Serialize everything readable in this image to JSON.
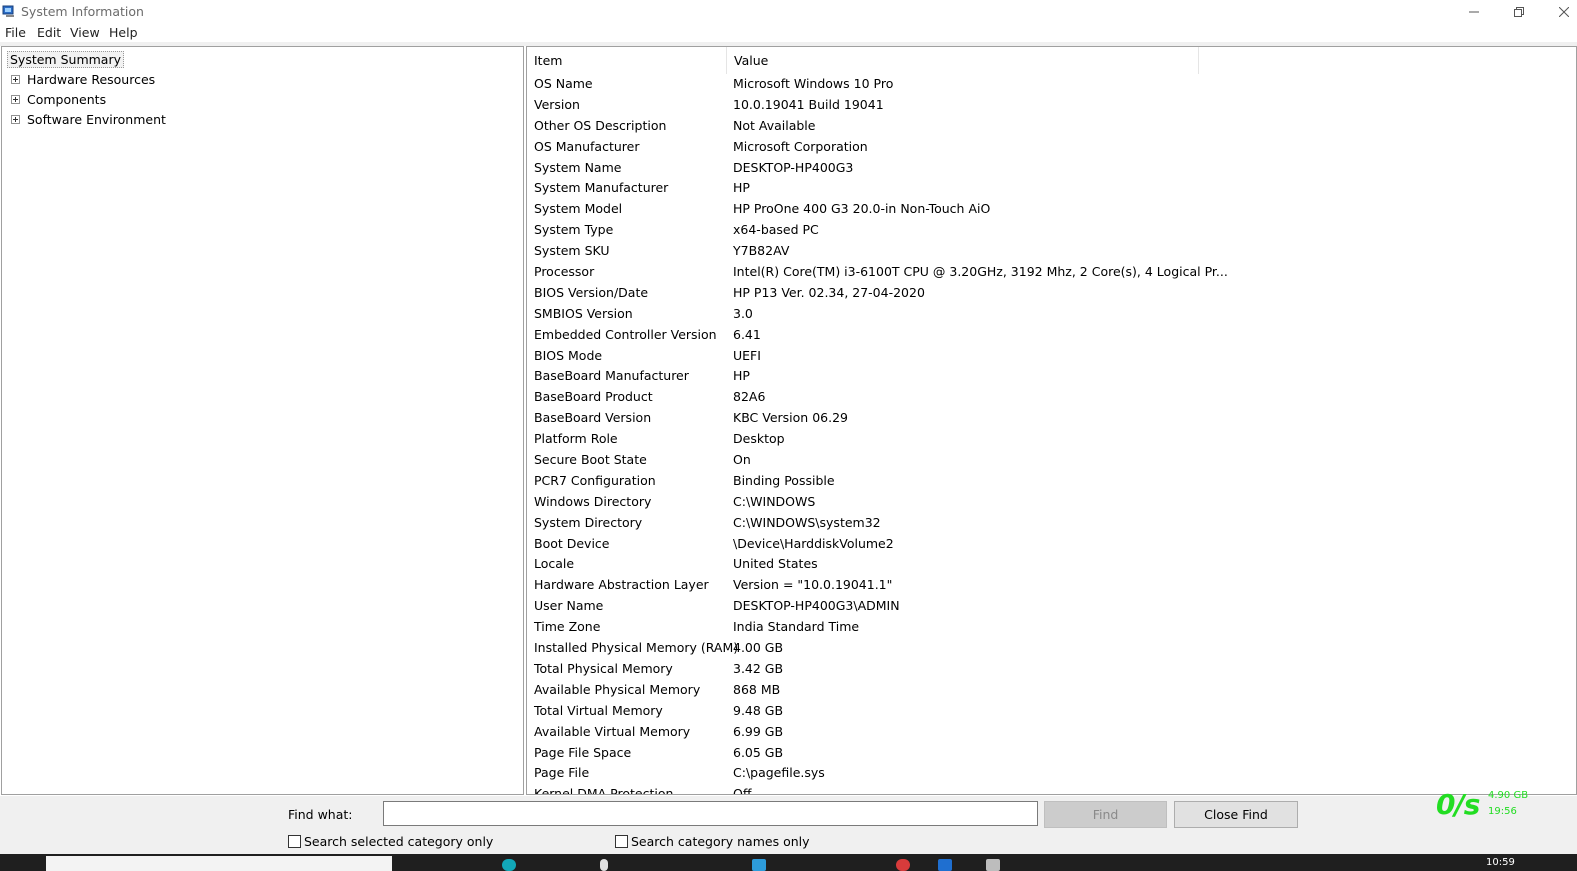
{
  "window": {
    "title": "System Information",
    "icon": "system-information-icon"
  },
  "menu": [
    "File",
    "Edit",
    "View",
    "Help"
  ],
  "tree": {
    "root": "System Summary",
    "children": [
      "Hardware Resources",
      "Components",
      "Software Environment"
    ]
  },
  "list": {
    "headers": {
      "item": "Item",
      "value": "Value"
    },
    "rows": [
      {
        "item": "OS Name",
        "value": "Microsoft Windows 10 Pro"
      },
      {
        "item": "Version",
        "value": "10.0.19041 Build 19041"
      },
      {
        "item": "Other OS Description",
        "value": "Not Available"
      },
      {
        "item": "OS Manufacturer",
        "value": "Microsoft Corporation"
      },
      {
        "item": "System Name",
        "value": "DESKTOP-HP400G3"
      },
      {
        "item": "System Manufacturer",
        "value": "HP"
      },
      {
        "item": "System Model",
        "value": "HP ProOne 400 G3 20.0-in Non-Touch AiO"
      },
      {
        "item": "System Type",
        "value": "x64-based PC"
      },
      {
        "item": "System SKU",
        "value": "Y7B82AV"
      },
      {
        "item": "Processor",
        "value": "Intel(R) Core(TM) i3-6100T CPU @ 3.20GHz, 3192 Mhz, 2 Core(s), 4 Logical Pr..."
      },
      {
        "item": "BIOS Version/Date",
        "value": "HP P13 Ver. 02.34, 27-04-2020"
      },
      {
        "item": "SMBIOS Version",
        "value": "3.0"
      },
      {
        "item": "Embedded Controller Version",
        "value": "6.41"
      },
      {
        "item": "BIOS Mode",
        "value": "UEFI"
      },
      {
        "item": "BaseBoard Manufacturer",
        "value": "HP"
      },
      {
        "item": "BaseBoard Product",
        "value": "82A6"
      },
      {
        "item": "BaseBoard Version",
        "value": "KBC Version 06.29"
      },
      {
        "item": "Platform Role",
        "value": "Desktop"
      },
      {
        "item": "Secure Boot State",
        "value": "On"
      },
      {
        "item": "PCR7 Configuration",
        "value": "Binding Possible"
      },
      {
        "item": "Windows Directory",
        "value": "C:\\WINDOWS"
      },
      {
        "item": "System Directory",
        "value": "C:\\WINDOWS\\system32"
      },
      {
        "item": "Boot Device",
        "value": "\\Device\\HarddiskVolume2"
      },
      {
        "item": "Locale",
        "value": "United States"
      },
      {
        "item": "Hardware Abstraction Layer",
        "value": "Version = \"10.0.19041.1\""
      },
      {
        "item": "User Name",
        "value": "DESKTOP-HP400G3\\ADMIN"
      },
      {
        "item": "Time Zone",
        "value": "India Standard Time"
      },
      {
        "item": "Installed Physical Memory (RAM)",
        "value": "4.00 GB"
      },
      {
        "item": "Total Physical Memory",
        "value": "3.42 GB"
      },
      {
        "item": "Available Physical Memory",
        "value": "868 MB"
      },
      {
        "item": "Total Virtual Memory",
        "value": "9.48 GB"
      },
      {
        "item": "Available Virtual Memory",
        "value": "6.99 GB"
      },
      {
        "item": "Page File Space",
        "value": "6.05 GB"
      },
      {
        "item": "Page File",
        "value": "C:\\pagefile.sys"
      },
      {
        "item": "Kernel DMA Protection",
        "value": "Off"
      }
    ]
  },
  "find": {
    "label": "Find what:",
    "value": "",
    "find_button": "Find",
    "close_button": "Close Find",
    "check_selected": "Search selected category only",
    "check_names": "Search category names only"
  },
  "netmeter": {
    "speed": "0/s",
    "size": "4.90 GB",
    "time": "19:56",
    "color": "#22dd22"
  },
  "taskbar": {
    "clock": "10:59"
  }
}
